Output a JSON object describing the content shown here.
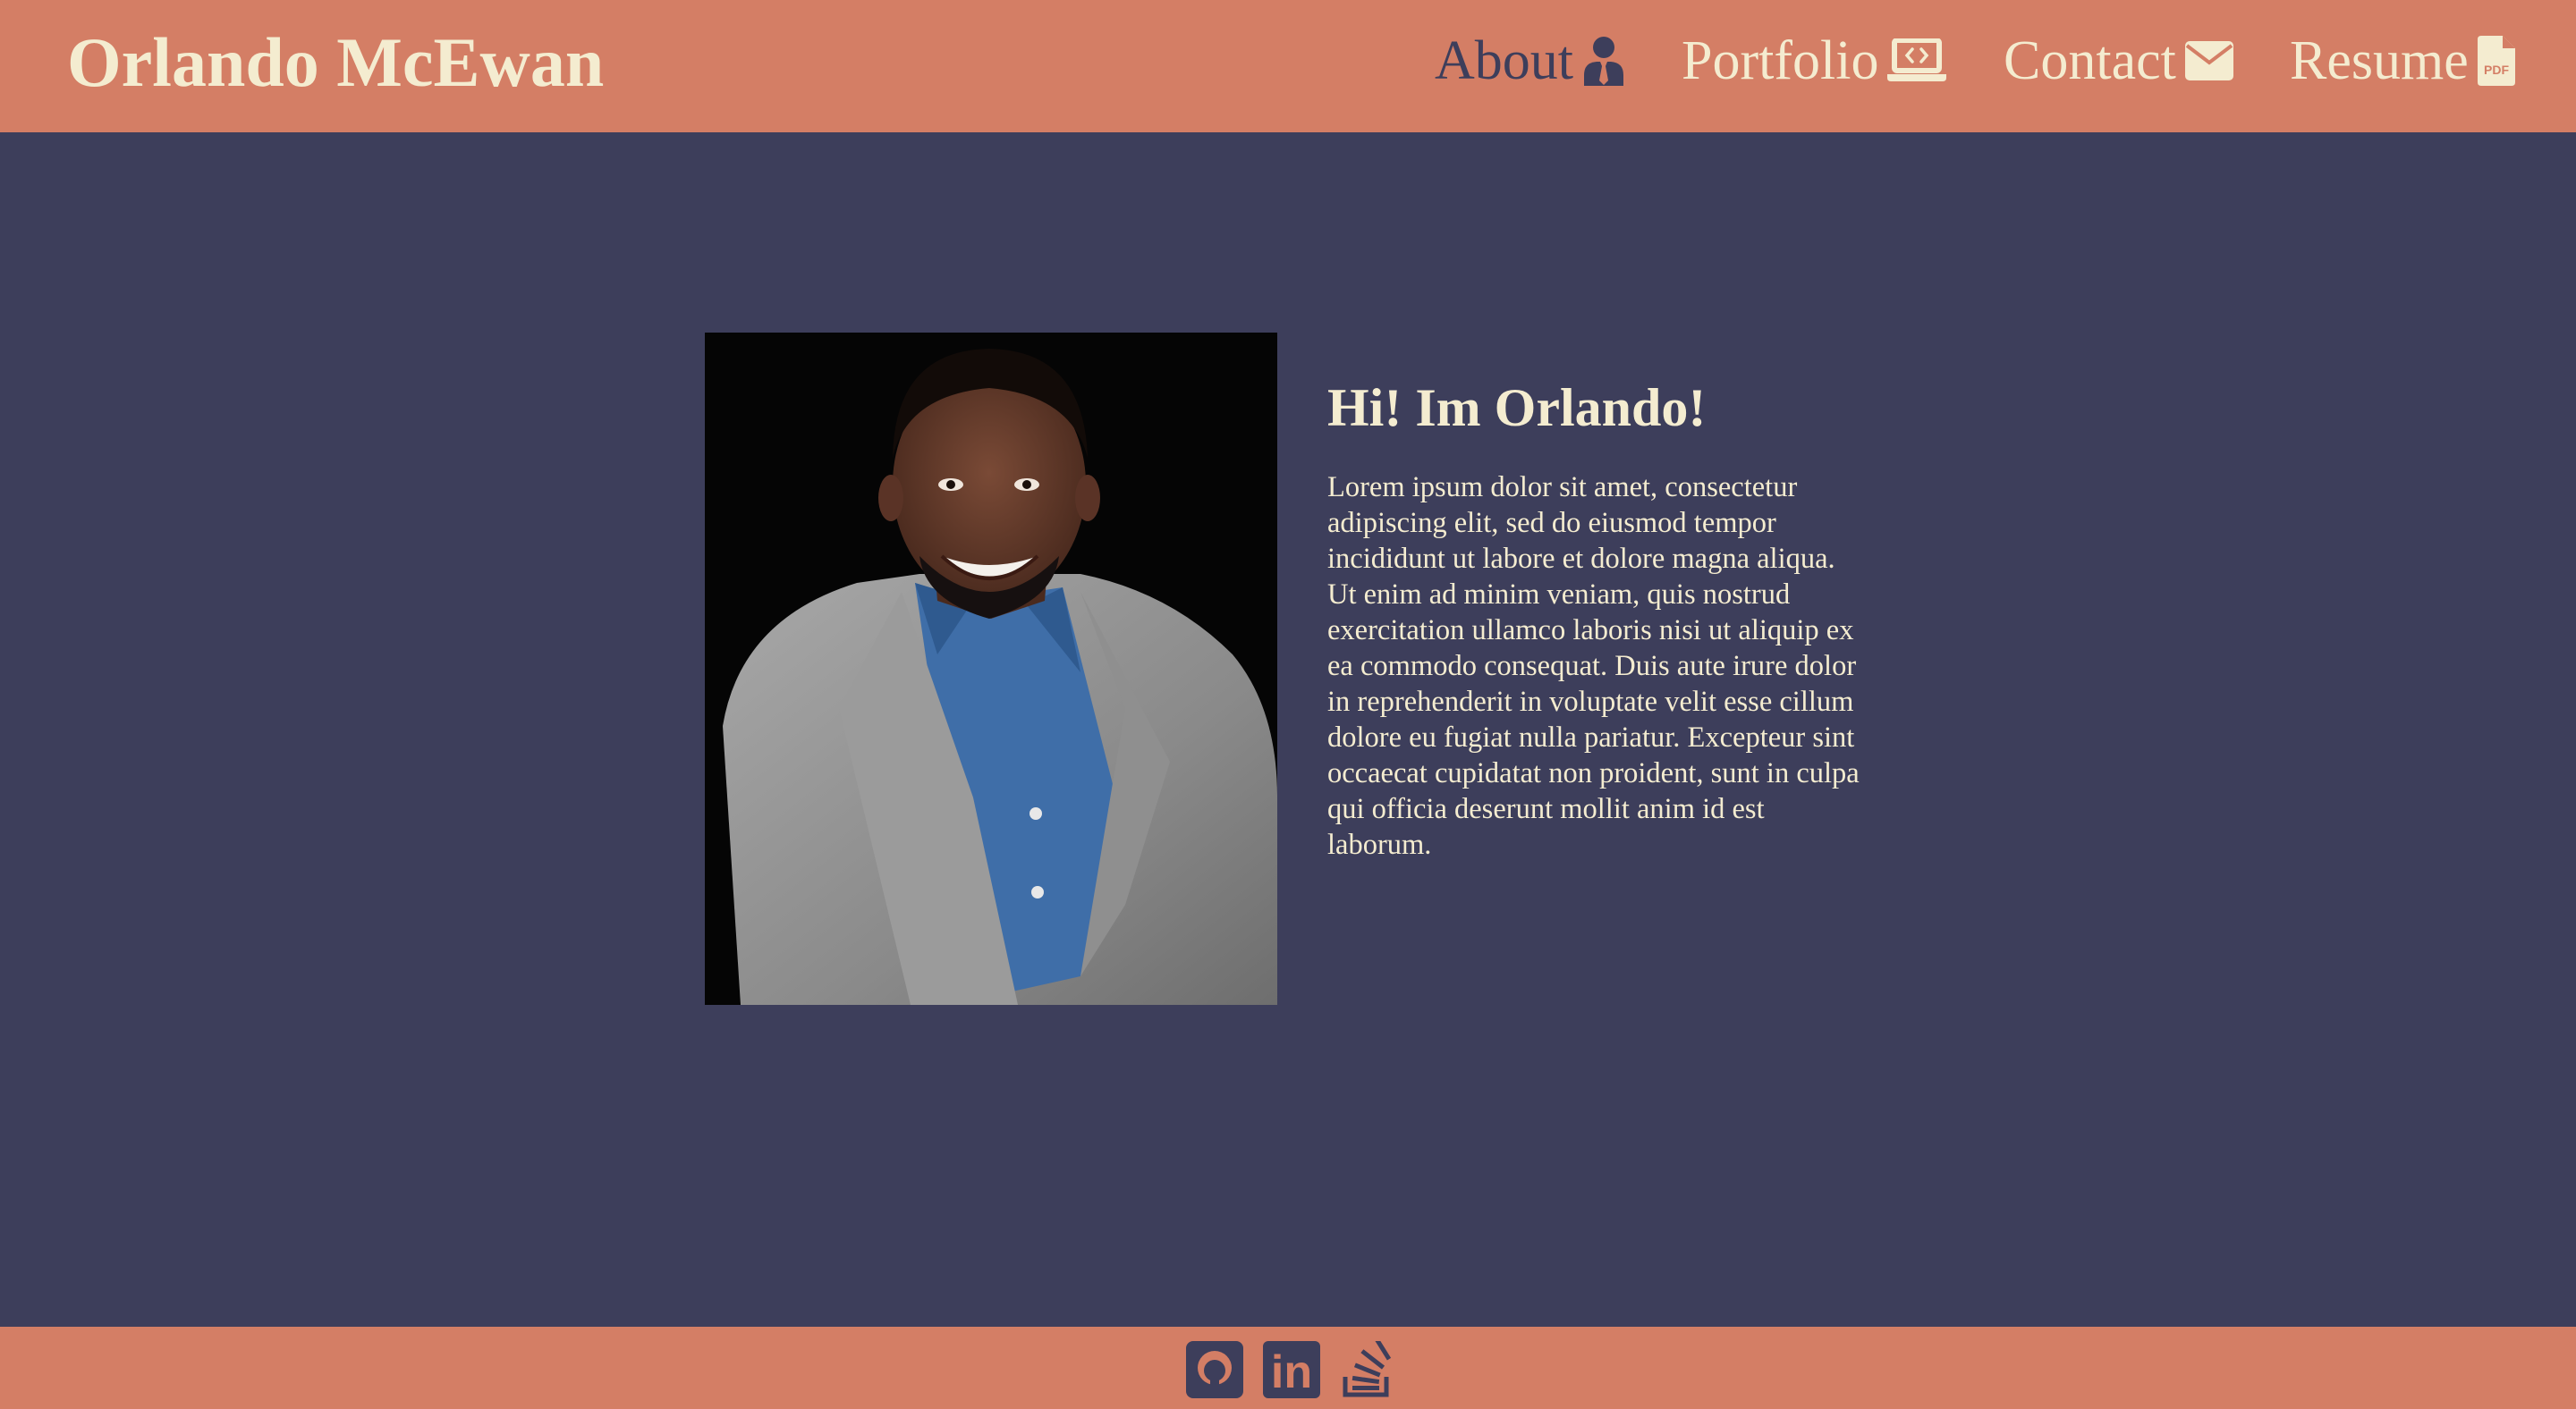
{
  "header": {
    "site_title": "Orlando McEwan",
    "nav": [
      {
        "label": "About",
        "icon": "user-tie-icon"
      },
      {
        "label": "Portfolio",
        "icon": "laptop-code-icon"
      },
      {
        "label": "Contact",
        "icon": "envelope-icon"
      },
      {
        "label": "Resume",
        "icon": "file-pdf-icon",
        "icon_text": "PDF"
      }
    ]
  },
  "main": {
    "greeting": "Hi! Im Orlando!",
    "bio": "Lorem ipsum dolor sit amet, consectetur adipiscing elit, sed do eiusmod tempor incididunt ut labore et dolore magna aliqua. Ut enim ad minim veniam, quis nostrud exercitation ullamco laboris nisi ut aliquip ex ea commodo consequat. Duis aute irure dolor in reprehenderit in voluptate velit esse cillum dolore eu fugiat nulla pariatur. Excepteur sint occaecat cupidatat non proident, sunt in culpa qui officia deserunt mollit anim id est laborum."
  },
  "footer": {
    "social": [
      {
        "icon": "github-icon"
      },
      {
        "icon": "linkedin-icon",
        "icon_text": "in"
      },
      {
        "icon": "stack-overflow-icon"
      }
    ]
  },
  "colors": {
    "accent": "#d47e65",
    "background": "#3d3e5b",
    "text_light": "#f4ecd0",
    "active_nav": "#3d3e5b"
  }
}
